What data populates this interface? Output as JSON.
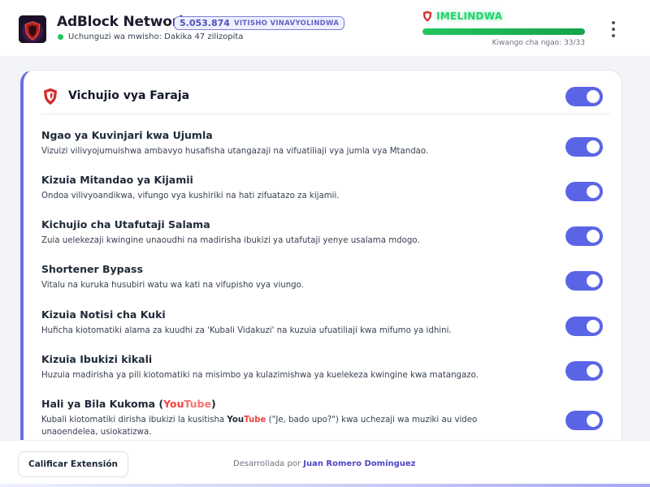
{
  "colors": {
    "accent": "#5a65e6",
    "status_green": "#22c55e",
    "shield_red": "#d32f2f",
    "youtube_red": "#ef4444"
  },
  "header": {
    "logo_icon": "adblock-shield-logo",
    "logo_text": "AdBlock",
    "title": "AdBlock Network",
    "counter": {
      "value": "5.053.874",
      "label": "VITISHO VINAVYOLINDWA"
    },
    "status_text": "Uchunguzi wa mwisho: Dakika 47 zilizopita",
    "shield_state": "IMELINDWA",
    "protection": {
      "label": "Kiwango cha ngao: 33/33",
      "current": 33,
      "total": 33
    },
    "menu_icon": "kebab-menu-icon"
  },
  "card": {
    "title": "Vichujio vya Faraja",
    "enabled": true,
    "items": [
      {
        "title": "Ngao ya Kuvinjari kwa Ujumla",
        "description": "Vizuizi vilivyojumuishwa ambavyo husafisha utangazaji na vifuatiliaji vya jumla vya Mtandao.",
        "enabled": true
      },
      {
        "title": "Kizuia Mitandao ya Kijamii",
        "description": "Ondoa vilivyoandikwa, vifungo vya kushiriki na hati zifuatazo za kijamii.",
        "enabled": true
      },
      {
        "title": "Kichujio cha Utafutaji Salama",
        "description": "Zuia uelekezaji kwingine unaoudhi na madirisha ibukizi ya utafutaji yenye usalama mdogo.",
        "enabled": true
      },
      {
        "title": "Shortener Bypass",
        "description": "Vitalu na kuruka husubiri watu wa kati na vifupisho vya viungo.",
        "enabled": true
      },
      {
        "title": "Kizuia Notisi cha Kuki",
        "description": "Huficha kiotomatiki alama za kuudhi za 'Kubali Vidakuzi' na kuzuia ufuatiliaji kwa mifumo ya idhini.",
        "enabled": true
      },
      {
        "title": "Kizuia Ibukizi kikali",
        "description": "Huzuia madirisha ya pili kiotomatiki na misimbo ya kulazimishwa ya kuelekeza kwingine kwa matangazo.",
        "enabled": true
      }
    ],
    "youtube_item": {
      "title_prefix": "Hali ya Bila Kukoma (",
      "title_suffix": ")",
      "brand_you": "You",
      "brand_tube": "Tube",
      "desc_before": "Kubali kiotomatiki dirisha ibukizi la kusitisha ",
      "desc_after": " (\"Je, bado upo?\") kwa uchezaji wa muziki au video unaoendelea, usiokatizwa.",
      "enabled": true
    }
  },
  "footer": {
    "rate_button": "Calificar Extensión",
    "credit_prefix": "Desarrollada por ",
    "credit_author": "Juan Romero Dominguez"
  }
}
